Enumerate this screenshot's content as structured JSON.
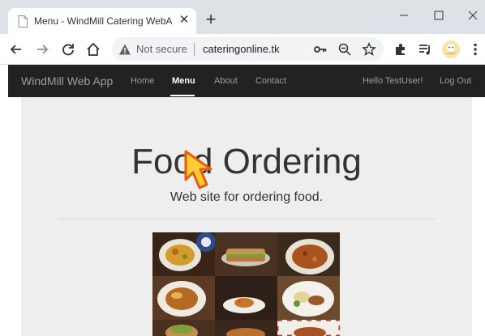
{
  "browser": {
    "tab_title": "Menu - WindMill Catering WebA",
    "address_security": "Not secure",
    "url": "cateringonline.tk",
    "icons": [
      "document-favicon-icon",
      "close-icon",
      "plus-icon",
      "minimize-icon",
      "maximize-icon",
      "window-close-icon",
      "back-arrow-icon",
      "forward-arrow-icon",
      "reload-icon",
      "home-icon",
      "warning-icon",
      "key-icon",
      "zoom-icon",
      "star-icon",
      "extensions-puzzle-icon",
      "media-queue-icon",
      "avatar-icon",
      "menu-dots-icon"
    ]
  },
  "navbar": {
    "brand": "WindMill Web App",
    "links": [
      "Home",
      "Menu",
      "About",
      "Contact"
    ],
    "active": "Menu",
    "greeting": "Hello TestUser!",
    "logout": "Log Out"
  },
  "hero": {
    "title": "Food Ordering",
    "subtitle": "Web site for ordering food."
  },
  "colors": {
    "navbar_bg": "#222222",
    "jumbotron_bg": "#eeeeee",
    "cursor_fill": "#ffcc33",
    "cursor_stroke": "#e85c0d"
  }
}
